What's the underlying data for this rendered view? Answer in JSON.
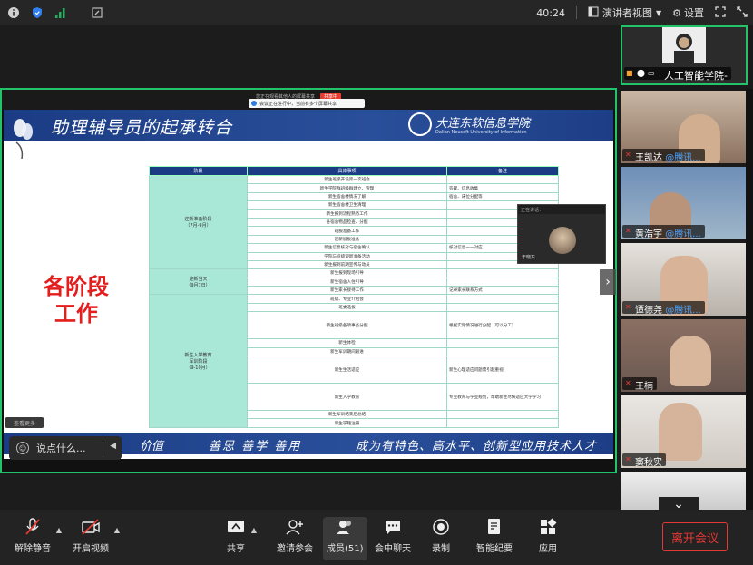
{
  "topbar": {
    "time": "40:24",
    "view_label": "演讲者视图",
    "settings_label": "设置"
  },
  "share": {
    "status_text": "您正在观看其他人的屏幕共享",
    "badge": "共享中",
    "notice": "会议正在进行中，当前有多个屏幕共享"
  },
  "slide": {
    "title": "助理辅导员的起承转合",
    "university": "大连东软信息学院",
    "university_en": "Dalian Neusoft University of Information",
    "big_label_line1": "各阶段",
    "big_label_line2": "工作",
    "table_headers": [
      "阶段",
      "具体事项",
      "备注"
    ],
    "phase1": "迎新准备阶段\n（7月-9月）",
    "phase2": "迎新当天\n（9月7日）",
    "phase3": "新生入学教育\n军训阶段\n（9-10月）",
    "rows_phase1": [
      {
        "item": "新生班级开设第一次班会",
        "note": ""
      },
      {
        "item": "新生学院群班级群建立、管理",
        "note": "答疑、信息收集"
      },
      {
        "item": "新生宿舍楼情况了解",
        "note": "宿舍、床位分配等"
      },
      {
        "item": "新生宿舍楼卫生清理",
        "note": ""
      },
      {
        "item": "新生报到流程熟悉工作",
        "note": ""
      },
      {
        "item": "各宿舍物品检查、分配",
        "note": ""
      },
      {
        "item": "班服准备工作",
        "note": ""
      },
      {
        "item": "迎新展板准备",
        "note": ""
      },
      {
        "item": "新生信息核对与宿舍确认",
        "note": "核对信息一一对应"
      },
      {
        "item": "学院与班级迎新准备活动",
        "note": ""
      },
      {
        "item": "新生报到前期宣传与动员",
        "note": ""
      }
    ],
    "rows_phase2": [
      {
        "item": "新生报到现场引导",
        "note": ""
      },
      {
        "item": "新生宿舍入住引导",
        "note": ""
      },
      {
        "item": "新生家长接待工作",
        "note": "记录家长联系方式"
      }
    ],
    "rows_phase3": [
      {
        "item": "班级、专业介绍会",
        "note": ""
      },
      {
        "item": "班委选拔",
        "note": ""
      },
      {
        "item": "新生班级各项事务分配",
        "note": "根据实际情况进行分配（可以分工）"
      },
      {
        "item": "新生体检",
        "note": ""
      },
      {
        "item": "新生军训期间跟进",
        "note": ""
      },
      {
        "item": "新生生活适应",
        "note": "新生心理适应问题需引起重视"
      },
      {
        "item": "新生入学教育",
        "note": "专业教育与学业规划，帮助新生尽快适应大学学习"
      },
      {
        "item": "新生军训结束后总结",
        "note": ""
      },
      {
        "item": "新生学籍注册",
        "note": ""
      }
    ],
    "motto_left": "价值",
    "motto_center": "善思 善学 善用",
    "motto_right": "成为有特色、高水平、创新型应用技术人才"
  },
  "mini_video": {
    "bar_text": "正在讲话：",
    "name": "于晓东"
  },
  "chat": {
    "placeholder": "说点什么...",
    "tag": "查看更多"
  },
  "participants": [
    {
      "name": "人工智能学院-",
      "tag": ""
    },
    {
      "name": "王凯达",
      "tag": "@腾讯..."
    },
    {
      "name": "黄浩宇",
      "tag": "@腾讯..."
    },
    {
      "name": "谭德尧",
      "tag": "@腾讯..."
    },
    {
      "name": "王楠",
      "tag": ""
    },
    {
      "name": "窦秋实",
      "tag": ""
    }
  ],
  "toolbar": {
    "mute_label": "解除静音",
    "video_label": "开启视频",
    "share_label": "共享",
    "invite_label": "邀请参会",
    "members_label": "成员(51)",
    "chat_label": "会中聊天",
    "record_label": "录制",
    "notes_label": "智能纪要",
    "apps_label": "应用",
    "leave_label": "离开会议"
  }
}
